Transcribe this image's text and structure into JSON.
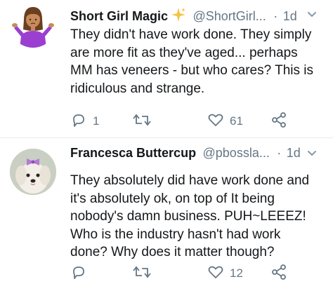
{
  "tweets": [
    {
      "name": "Short Girl Magic",
      "handle": "@ShortGirl...",
      "dot": "·",
      "time": "1d",
      "text": "They didn't have work done. They simply\nare more fit as they've aged... perhaps\nMM has veneers - but who cares? This is\nridiculous and strange.",
      "reply_count": "1",
      "retweet_count": "",
      "like_count": "61"
    },
    {
      "name": "Francesca Buttercup",
      "handle": "@pbossla...",
      "dot": "·",
      "time": "1d",
      "text": "They absolutely did have work done and\nit's absolutely ok, on top of It being\nnobody's damn business.  PUH~LEEEZ!\nWho is the industry hasn't had work\ndone?  Why does it matter though?",
      "reply_count": "",
      "retweet_count": "",
      "like_count": "12"
    }
  ],
  "icons": {
    "avatar1": "person-shrugging-emoji",
    "avatar2": "white-dog-with-bow-photo",
    "sparkle": "sparkles-icon",
    "caret": "chevron-down-icon",
    "reply": "reply-icon",
    "retweet": "retweet-icon",
    "like": "heart-icon",
    "share": "share-icon"
  },
  "colors": {
    "text": "#14171a",
    "muted": "#657786",
    "sparkle": "#f5c242",
    "divider": "#e6ecf0"
  }
}
